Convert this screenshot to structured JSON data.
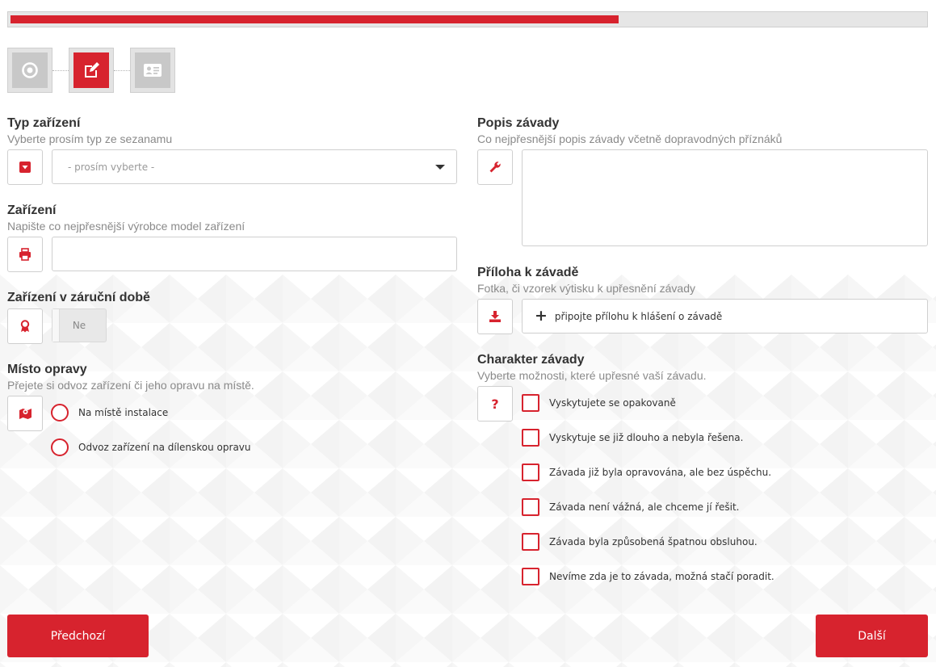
{
  "progress": {
    "fraction": 0.665
  },
  "steps": [
    {
      "icon": "target-icon",
      "active": false
    },
    {
      "icon": "edit-icon",
      "active": true
    },
    {
      "icon": "id-card-icon",
      "active": false
    }
  ],
  "device_type": {
    "title": "Typ zařízení",
    "subtitle": "Vyberte prosím typ ze sezanamu",
    "select_value": "- prosím vyberte -",
    "icon": "caret-square-down-icon"
  },
  "device": {
    "title": "Zařízení",
    "subtitle": "Napište co nejpřesnější výrobce model zařízení",
    "value": "",
    "icon": "printer-icon"
  },
  "warranty": {
    "title": "Zařízení v záruční době",
    "toggle_label": "Ne",
    "icon": "award-icon"
  },
  "repair_place": {
    "title": "Místo opravy",
    "subtitle": "Přejete si odvoz zařízení či jeho opravu na místě.",
    "icon": "map-icon",
    "options": [
      "Na místě instalace",
      "Odvoz zařízení na dílenskou opravu"
    ]
  },
  "fault_description": {
    "title": "Popis závady",
    "subtitle": "Co nejpřesnější popis závady včetně dopravodných příznáků",
    "value": "",
    "icon": "wrench-icon"
  },
  "attachment": {
    "title": "Příloha k závadě",
    "subtitle": "Fotka, či vzorek výtisku k upřesnění závady",
    "button_label": "připojte přílohu k hlášení o závadě",
    "icon": "download-icon"
  },
  "fault_character": {
    "title": "Charakter závady",
    "subtitle": "Vyberte možnosti, které upřesné vaší závadu.",
    "icon_text": "?",
    "options": [
      "Vyskytujete se opakovaně",
      "Vyskytuje se již dlouho a nebyla řešena.",
      "Závada již byla opravována, ale bez úspěchu.",
      "Závada není vážná, ale chceme jí řešit.",
      "Závada byla způsobená špatnou obsluhou.",
      "Nevíme zda je to závada, možná stačí poradit."
    ]
  },
  "buttons": {
    "prev": "Předchozí",
    "next": "Další"
  },
  "colors": {
    "accent": "#d7232e",
    "border": "#cfcfcf",
    "muted": "#8a8a8a"
  }
}
